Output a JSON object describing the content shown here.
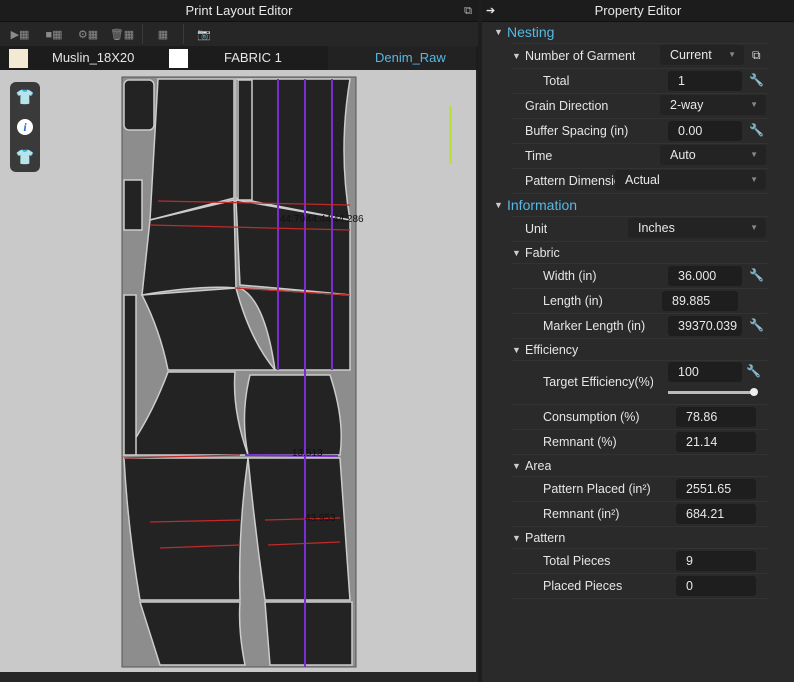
{
  "left_panel": {
    "title": "Print Layout Editor",
    "toolbar": [
      {
        "name": "nest-start-icon"
      },
      {
        "name": "nest-stop-icon"
      },
      {
        "name": "nest-settings-icon"
      },
      {
        "name": "nest-delete-icon"
      },
      {
        "name": "garment-icon"
      },
      {
        "name": "snapshot-icon"
      }
    ],
    "fabrics": [
      {
        "label": "Muslin_18X20",
        "color": "#f3ead3"
      },
      {
        "label": "FABRIC 1",
        "color": "#ffffff"
      },
      {
        "label": "Denim_Raw",
        "color": "#56b8e6"
      }
    ],
    "marker_labels": [
      "44.79",
      "44.44",
      "44.286",
      "13.513",
      "43.953"
    ]
  },
  "right_panel": {
    "title": "Property Editor",
    "rows": [
      {
        "type": "section",
        "label": "Nesting"
      },
      {
        "type": "select",
        "label": "Number of Garment",
        "value": "Current",
        "level": 1,
        "tri": true,
        "extra": "copy"
      },
      {
        "type": "input",
        "label": "Total",
        "value": "1",
        "level": 2
      },
      {
        "type": "select",
        "label": "Grain Direction",
        "value": "2-way",
        "level": 1
      },
      {
        "type": "input",
        "label": "Buffer Spacing (in)",
        "value": "0.00",
        "level": 1
      },
      {
        "type": "select",
        "label": "Time",
        "value": "Auto",
        "level": 1
      },
      {
        "type": "selectwide",
        "label": "Pattern Dimension",
        "value": "Actual",
        "level": 1
      },
      {
        "type": "section",
        "label": "Information"
      },
      {
        "type": "selectunit",
        "label": "Unit",
        "value": "Inches",
        "level": 1
      },
      {
        "type": "group",
        "label": "Fabric",
        "level": 1
      },
      {
        "type": "input",
        "label": "Width (in)",
        "value": "36.000",
        "level": 2
      },
      {
        "type": "plain",
        "label": "Length (in)",
        "value": "89.885",
        "level": 2
      },
      {
        "type": "input",
        "label": "Marker Length (in)",
        "value": "39370.039",
        "level": 2
      },
      {
        "type": "group",
        "label": "Efficiency",
        "level": 1
      },
      {
        "type": "slider",
        "label": "Target Efficiency(%)",
        "value": "100",
        "level": 2,
        "slider_fraction": 1.0
      },
      {
        "type": "readonly",
        "label": "Consumption (%)",
        "value": "78.86",
        "level": 2
      },
      {
        "type": "readonly",
        "label": "Remnant (%)",
        "value": "21.14",
        "level": 2
      },
      {
        "type": "group",
        "label": "Area",
        "level": 1
      },
      {
        "type": "readonly",
        "label": "Pattern Placed (in²)",
        "value": "2551.65",
        "level": 2
      },
      {
        "type": "readonly",
        "label": "Remnant (in²)",
        "value": "684.21",
        "level": 2
      },
      {
        "type": "group",
        "label": "Pattern",
        "level": 1
      },
      {
        "type": "readonly",
        "label": "Total Pieces",
        "value": "9",
        "level": 2
      },
      {
        "type": "readonly",
        "label": "Placed Pieces",
        "value": "0",
        "level": 2
      }
    ]
  }
}
